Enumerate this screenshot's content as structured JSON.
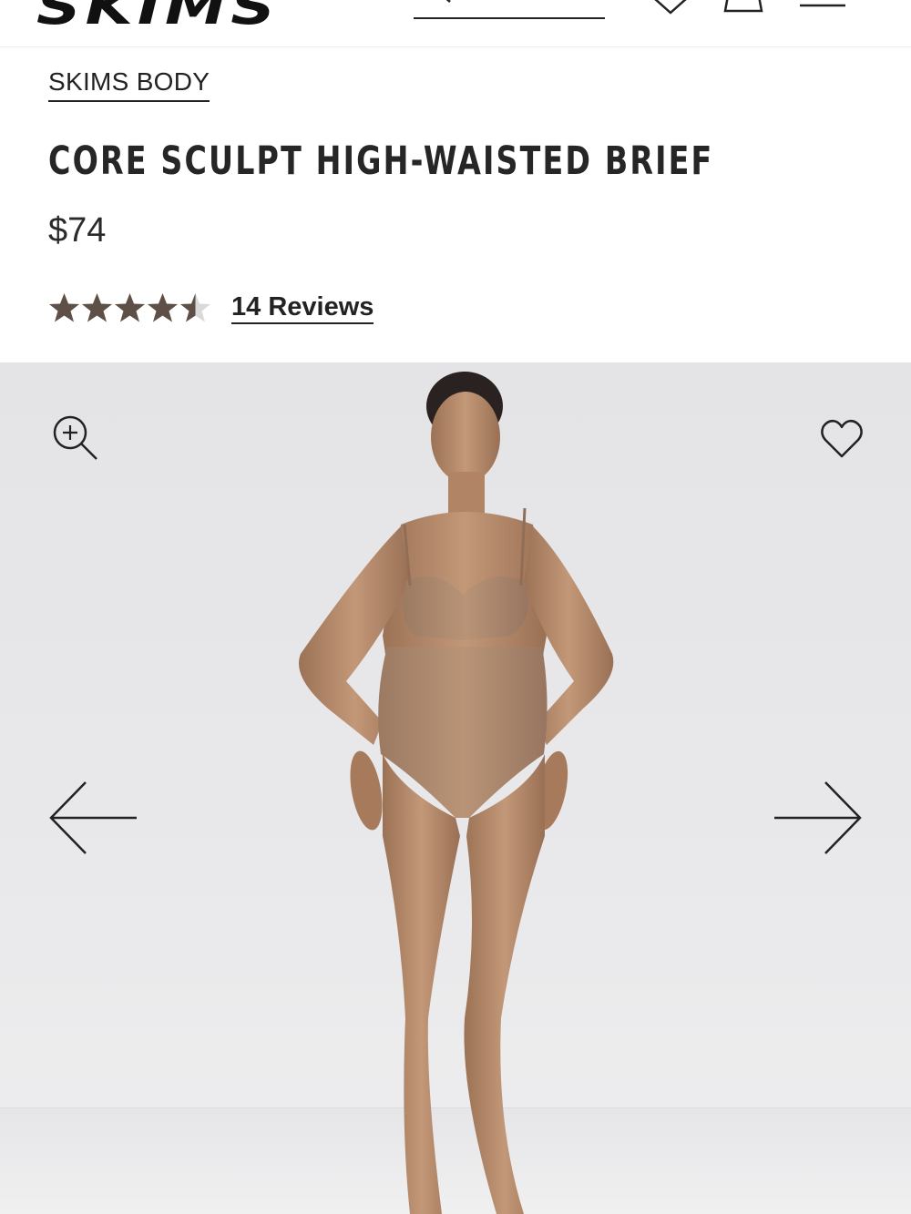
{
  "header": {
    "logo_text": "SKIMS",
    "icons": [
      "search-icon",
      "heart-icon",
      "bag-icon",
      "menu-icon"
    ]
  },
  "product": {
    "brand": "SKIMS BODY",
    "title": "CORE SCULPT HIGH-WAISTED BRIEF",
    "price": "$74",
    "rating": 4.5,
    "rating_max": 5,
    "reviews_label": "14 Reviews"
  },
  "gallery": {
    "icons": [
      "zoom-in-icon",
      "heart-icon",
      "arrow-left-icon",
      "arrow-right-icon"
    ]
  },
  "colors": {
    "text": "#222222",
    "star": "#5e5046",
    "star_empty": "#d9d9d9",
    "gallery_bg": "#e6e6e8",
    "garment": "#a88468",
    "skin": "#b58a6c"
  }
}
